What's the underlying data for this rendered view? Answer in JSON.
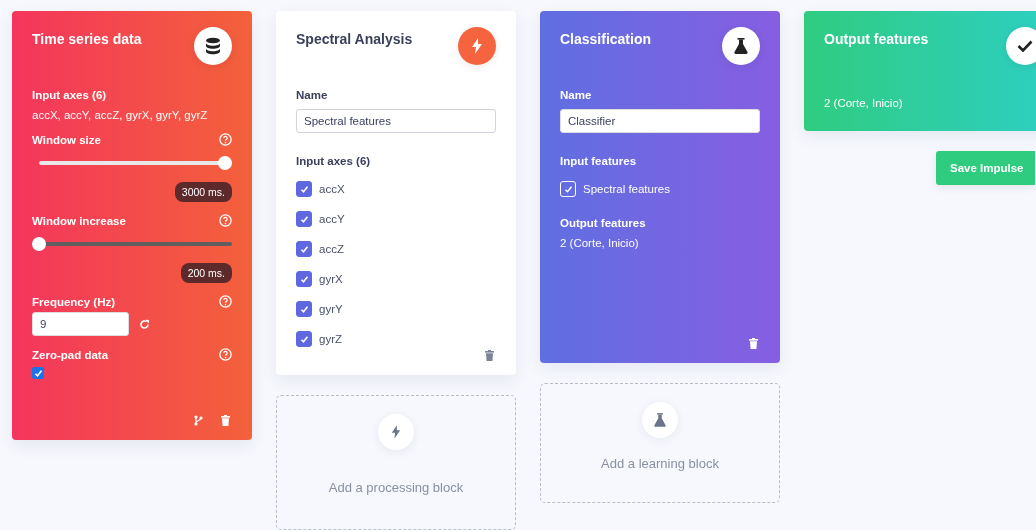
{
  "time_series": {
    "title": "Time series data",
    "input_axes_label": "Input axes (6)",
    "input_axes": "accX, accY, accZ, gyrX, gyrY, gyrZ",
    "window_size": {
      "label": "Window size",
      "level": 1,
      "reading": "3000 ms."
    },
    "window_increase": {
      "label": "Window increase",
      "level": 0,
      "reading": "200 ms."
    },
    "frequency": {
      "label": "Frequency (Hz)",
      "value": "9"
    },
    "zero_pad": {
      "label": "Zero-pad data",
      "checked": true
    }
  },
  "spectral": {
    "title": "Spectral Analysis",
    "name_label": "Name",
    "name_value": "Spectral features",
    "axes_label": "Input axes (6)",
    "axes": [
      {
        "label": "accX",
        "checked": true
      },
      {
        "label": "accY",
        "checked": true
      },
      {
        "label": "accZ",
        "checked": true
      },
      {
        "label": "gyrX",
        "checked": true
      },
      {
        "label": "gyrY",
        "checked": true
      },
      {
        "label": "gyrZ",
        "checked": true
      }
    ]
  },
  "add_processing": "Add a processing block",
  "classification": {
    "title": "Classification",
    "name_label": "Name",
    "name_value": "Classifier",
    "input_label": "Input features",
    "inputs": [
      {
        "label": "Spectral features",
        "checked": true
      }
    ],
    "output_label": "Output features",
    "output_value": "2 (Corte, Inicio)"
  },
  "add_learning": "Add a learning block",
  "output": {
    "title": "Output features",
    "value": "2 (Corte, Inicio)"
  },
  "save_button": "Save Impulse"
}
